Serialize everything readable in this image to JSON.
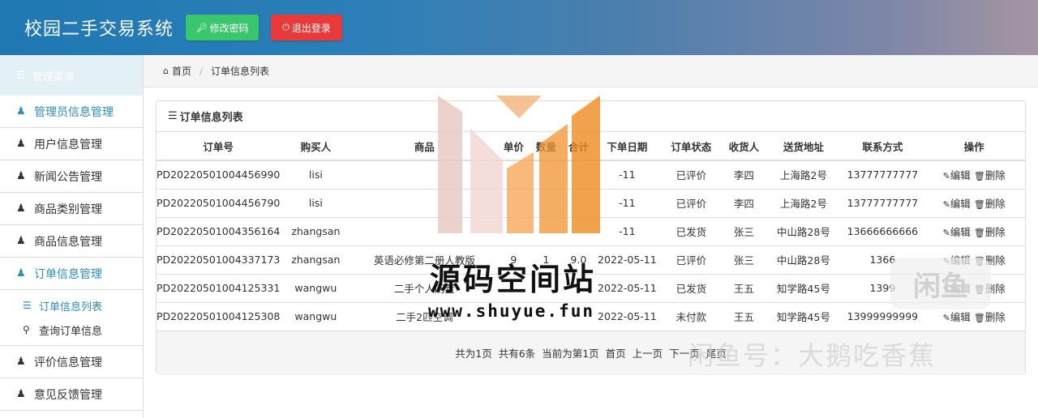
{
  "header": {
    "app_title": "校园二手交易系统",
    "change_password_label": "修改密码",
    "logout_label": "退出登录"
  },
  "sidebar": {
    "menu_title": "管理菜单",
    "items": [
      {
        "label": "管理员信息管理"
      },
      {
        "label": "用户信息管理"
      },
      {
        "label": "新闻公告管理"
      },
      {
        "label": "商品类别管理"
      },
      {
        "label": "商品信息管理"
      },
      {
        "label": "订单信息管理"
      },
      {
        "label": "评价信息管理"
      },
      {
        "label": "意见反馈管理"
      }
    ],
    "sub_items": [
      {
        "label": "订单信息列表"
      },
      {
        "label": "查询订单信息"
      }
    ]
  },
  "breadcrumb": {
    "home": "首页",
    "current": "订单信息列表"
  },
  "panel": {
    "title": "订单信息列表"
  },
  "table": {
    "headers": [
      "订单号",
      "购买人",
      "商品",
      "单价",
      "数量",
      "合计",
      "下单日期",
      "订单状态",
      "收货人",
      "送货地址",
      "联系方式",
      "操作"
    ],
    "rows": [
      {
        "order_no": "PD20220501004456990",
        "buyer": "lisi",
        "product": "",
        "price": "",
        "qty": "",
        "total": "",
        "date": "-11",
        "status": "已评价",
        "receiver": "李四",
        "address": "上海路2号",
        "phone": "13777777777"
      },
      {
        "order_no": "PD20220501004456790",
        "buyer": "lisi",
        "product": "",
        "price": "",
        "qty": "",
        "total": "",
        "date": "-11",
        "status": "已评价",
        "receiver": "李四",
        "address": "上海路2号",
        "phone": "13777777777"
      },
      {
        "order_no": "PD20220501004356164",
        "buyer": "zhangsan",
        "product": "",
        "price": "",
        "qty": "",
        "total": "",
        "date": "-11",
        "status": "已发货",
        "receiver": "张三",
        "address": "中山路28号",
        "phone": "13666666666"
      },
      {
        "order_no": "PD20220501004337173",
        "buyer": "zhangsan",
        "product": "英语必修第二册人教版",
        "price": "9",
        "qty": "1",
        "total": "9.0",
        "date": "2022-05-11",
        "status": "已评价",
        "receiver": "张三",
        "address": "中山路28号",
        "phone": "1366"
      },
      {
        "order_no": "PD20220501004125331",
        "buyer": "wangwu",
        "product": "二手个人闲置",
        "price": "",
        "qty": "",
        "total": "",
        "date": "2022-05-11",
        "status": "已发货",
        "receiver": "王五",
        "address": "知学路45号",
        "phone": "1399"
      },
      {
        "order_no": "PD20220501004125308",
        "buyer": "wangwu",
        "product": "二手2匹空调",
        "price": "",
        "qty": "",
        "total": "",
        "date": "2022-05-11",
        "status": "未付款",
        "receiver": "王五",
        "address": "知学路45号",
        "phone": "13999999999"
      }
    ],
    "edit_label": "编辑",
    "delete_label": "删除"
  },
  "pager": {
    "total_pages": "共为1页",
    "total_items": "共有6条",
    "current": "当前为第1页",
    "first": "首页",
    "prev": "上一页",
    "next": "下一页",
    "last": "尾页"
  },
  "watermark": {
    "site_name": "源码空间站",
    "site_url": "www.shuyue.fun",
    "xianyu_text": "闲鱼号：大鹅吃香蕉",
    "xianyu_logo": "闲鱼"
  },
  "colors": {
    "accent": "#2f8ec0",
    "btn_green": "#3ac66d",
    "btn_red": "#e83a3a"
  }
}
